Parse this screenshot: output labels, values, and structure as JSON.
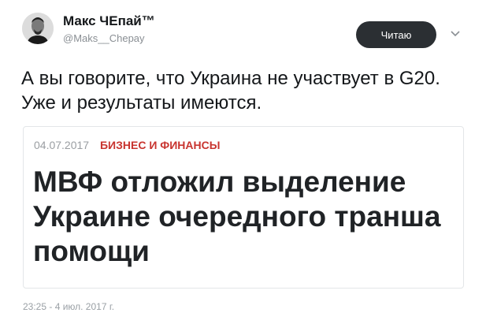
{
  "author": {
    "display_name": "Макс ЧЕпай™",
    "handle": "@Maks__Chepay"
  },
  "follow_button": {
    "label": "Читаю"
  },
  "caret_icon": "chevron-down-icon",
  "tweet": {
    "text": "А вы говорите, что Украина не участвует в G20. Уже и результаты имеются."
  },
  "card": {
    "date": "04.07.2017",
    "category": "БИЗНЕС И ФИНАНСЫ",
    "headline": "МВФ отложил выделение Украине очередного транша помощи"
  },
  "timestamp": "23:25 - 4 июл. 2017 г.",
  "colors": {
    "follow_button_bg": "#2b2f33",
    "category_red": "#c8342f",
    "meta_gray": "#9a9ea2"
  }
}
